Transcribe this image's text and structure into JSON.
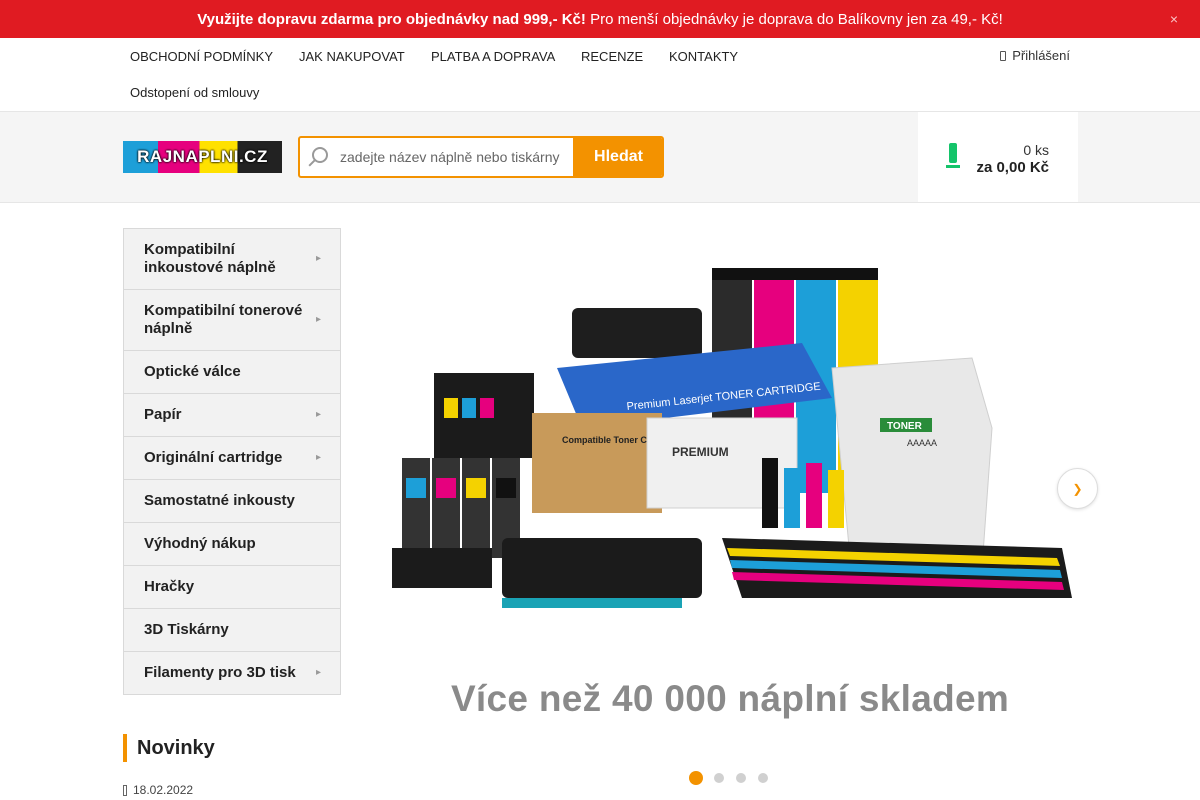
{
  "promo": {
    "bold_text": "Využijte dopravu zdarma pro objednávky nad 999,- Kč!",
    "text": " Pro menší objednávky je doprava do Balíkovny jen za 49,- Kč!",
    "close_icon": "×"
  },
  "topnav": {
    "links": [
      "OBCHODNÍ PODMÍNKY",
      "JAK NAKUPOVAT",
      "PLATBA A DOPRAVA",
      "RECENZE",
      "KONTAKTY",
      "Odstopení od smlouvy"
    ],
    "login_label": "Přihlášení"
  },
  "header": {
    "logo_text": "RAJNAPLNI.CZ",
    "search_placeholder": "zadejte název náplně nebo tiskárny",
    "search_button": "Hledat",
    "cart_qty": "0 ks",
    "cart_total": "za 0,00 Kč"
  },
  "sidebar": {
    "items": [
      {
        "label": "Kompatibilní inkoustové náplně",
        "has_children": true
      },
      {
        "label": "Kompatibilní tonerové náplně",
        "has_children": true
      },
      {
        "label": "Optické válce",
        "has_children": false
      },
      {
        "label": "Papír",
        "has_children": true
      },
      {
        "label": "Originální cartridge",
        "has_children": true
      },
      {
        "label": "Samostatné inkousty",
        "has_children": false
      },
      {
        "label": "Výhodný nákup",
        "has_children": false
      },
      {
        "label": "Hračky",
        "has_children": false
      },
      {
        "label": "3D Tiskárny",
        "has_children": false
      },
      {
        "label": "Filamenty pro 3D tisk",
        "has_children": true
      }
    ]
  },
  "banner": {
    "caption": "Více než 40 000 náplní skladem",
    "slide_count": 4,
    "active_slide": 1,
    "image_labels": {
      "toner_box": "Premium Laserjet TONER CARTRIDGE",
      "premium_box": "PREMIUM",
      "compat_box": "Compatible Toner Cartridge",
      "bag_brand": "TONER",
      "bag_code": "AAAAA"
    }
  },
  "news": {
    "title": "Novinky",
    "date": "18.02.2022"
  },
  "colors": {
    "promo_red": "#e01b22",
    "accent_orange": "#f39200",
    "cart_green": "#14c46a"
  }
}
